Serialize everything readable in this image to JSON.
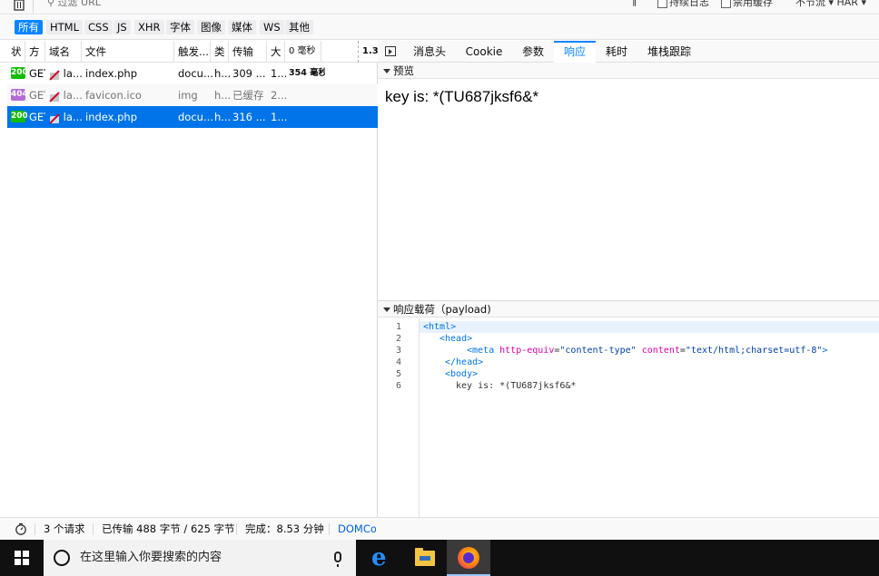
{
  "toolbar": {
    "filter_placeholder": "过滤 URL",
    "pause_label": "‖",
    "persist_logs": "持续日志",
    "disable_cache": "禁用缓存",
    "throttle": "不节流 ▾ HAR ▾"
  },
  "filters": [
    "所有",
    "HTML",
    "CSS",
    "JS",
    "XHR",
    "字体",
    "图像",
    "媒体",
    "WS",
    "其他"
  ],
  "columns": {
    "status": "状",
    "method": "方",
    "domain": "域名",
    "file": "文件",
    "cause": "触发...",
    "type": "类",
    "transferred": "传输",
    "size": "大",
    "waterfall_start": "0 毫秒",
    "waterfall_end": "1.3"
  },
  "requests": [
    {
      "status": "200",
      "method": "GET",
      "domain": "la...",
      "file": "index.php",
      "cause": "docu...",
      "type": "h...",
      "transferred": "309 ...",
      "size": "1...",
      "timing": "354 毫秒"
    },
    {
      "status": "404",
      "method": "GET",
      "domain": "la...",
      "file": "favicon.ico",
      "cause": "img",
      "type": "h...",
      "transferred": "已缓存",
      "size": "2...",
      "timing": ""
    },
    {
      "status": "200",
      "method": "GET",
      "domain": "la...",
      "file": "index.php",
      "cause": "docu...",
      "type": "h...",
      "transferred": "316 ...",
      "size": "1...",
      "timing": ""
    }
  ],
  "statusbar": {
    "requests": "3 个请求",
    "transferred": "已传输 488 字节 / 625 字节",
    "finish": "完成：8.53 分钟",
    "domcontent": "DOMCo"
  },
  "tabs": [
    "消息头",
    "Cookie",
    "参数",
    "响应",
    "耗时",
    "堆栈跟踪"
  ],
  "active_tab": "响应",
  "preview": {
    "heading": "预览",
    "content": "key is: *(TU687jksf6&*"
  },
  "payload": {
    "heading": "响应载荷（payload)",
    "line_numbers": [
      "1",
      "2",
      "3",
      "4",
      "5",
      "6"
    ],
    "lines": {
      "l1_tag": "<html>",
      "l2_tag": "<head>",
      "l3_open": "<meta",
      "l3_attr1": "http-equiv",
      "l3_eq1": "=",
      "l3_val1": "\"content-type\"",
      "l3_attr2": "content",
      "l3_eq2": "=",
      "l3_val2": "\"text/html;charset=utf-8\"",
      "l3_close": ">",
      "l4_tag": "</head>",
      "l5_tag": "<body>",
      "l6_text": "key is: *(TU687jksf6&*"
    }
  },
  "taskbar": {
    "search_placeholder": "在这里输入你要搜索的内容"
  },
  "colors": {
    "accent": "#0a84ff",
    "selected_row": "#0074e8",
    "status_ok": "#12bc00",
    "status_notmodified": "#b66bda"
  }
}
